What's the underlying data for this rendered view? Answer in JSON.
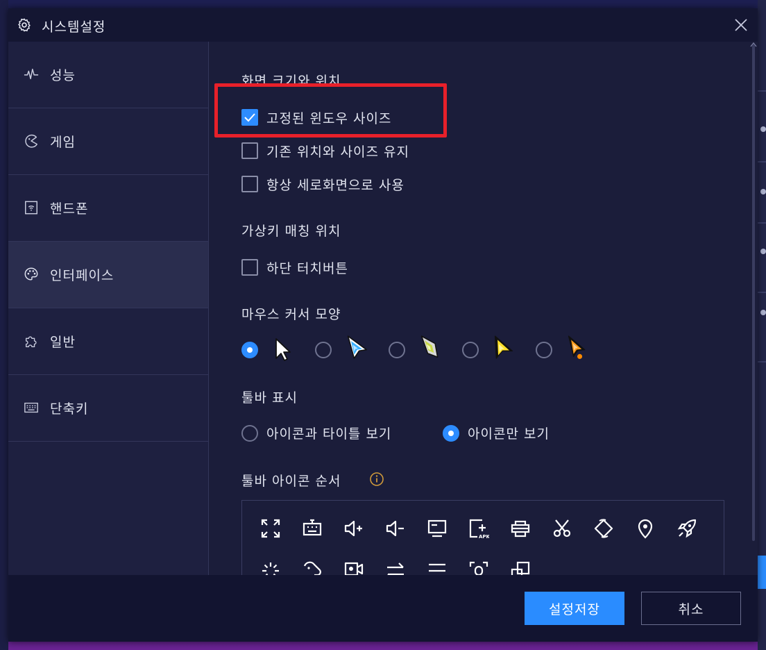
{
  "window": {
    "title": "시스템설정"
  },
  "sidebar": {
    "items": [
      {
        "label": "성능",
        "icon": "pulse-icon"
      },
      {
        "label": "게임",
        "icon": "gamepad-icon"
      },
      {
        "label": "핸드폰",
        "icon": "phone-icon"
      },
      {
        "label": "인터페이스",
        "icon": "palette-icon",
        "active": true
      },
      {
        "label": "일반",
        "icon": "puzzle-icon"
      },
      {
        "label": "단축키",
        "icon": "keyboard-icon"
      }
    ]
  },
  "screen": {
    "section_title": "화면 크기와 위치",
    "options": [
      {
        "label": "고정된 윈도우 사이즈",
        "checked": true
      },
      {
        "label": "기존 위치와 사이즈 유지",
        "checked": false
      },
      {
        "label": "항상 세로화면으로 사용",
        "checked": false
      }
    ]
  },
  "keymap": {
    "section_title": "가상키 매칭 위치",
    "options": [
      {
        "label": "하단 터치버튼",
        "checked": false
      }
    ]
  },
  "cursor": {
    "section_title": "마우스 커서 모양",
    "options": [
      {
        "name": "white-arrow-cursor",
        "selected": true
      },
      {
        "name": "blue-arrow-cursor",
        "selected": false
      },
      {
        "name": "green-arrow-cursor",
        "selected": false
      },
      {
        "name": "yellow-arrow-cursor",
        "selected": false
      },
      {
        "name": "orange-arrow-cursor",
        "selected": false
      }
    ]
  },
  "toolbar_display": {
    "section_title": "툴바 표시",
    "options": [
      {
        "label": "아이콘과 타이틀 보기",
        "selected": false
      },
      {
        "label": "아이콘만 보기",
        "selected": true
      }
    ]
  },
  "toolbar_order": {
    "section_title": "툴바 아이콘 순서",
    "icons": [
      "fullscreen-icon",
      "keyboard-icon",
      "volume-up-icon",
      "volume-down-icon",
      "screen-icon",
      "install-apk-icon",
      "printer-icon",
      "scissors-icon",
      "rotate-icon",
      "location-icon",
      "rocket-icon",
      "loading-icon",
      "record-operation-icon",
      "record-video-icon",
      "swap-icon",
      "menu-icon",
      "screenshot-icon",
      "multi-window-icon"
    ]
  },
  "footer": {
    "save_label": "설정저장",
    "cancel_label": "취소"
  },
  "colors": {
    "accent": "#2a8cff",
    "highlight": "#e8202a",
    "background": "#1b1d3a"
  }
}
